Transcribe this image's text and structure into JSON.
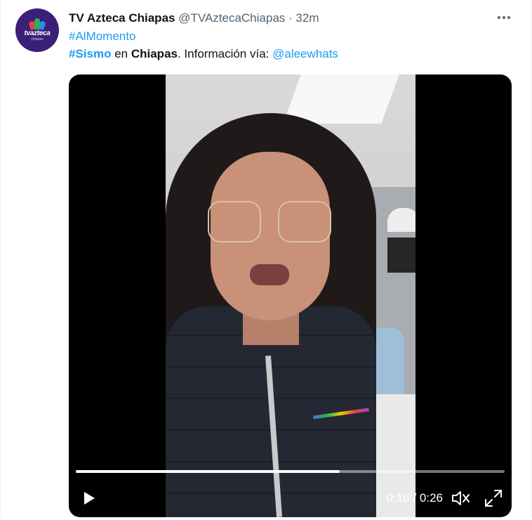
{
  "tweet": {
    "author_name": "TV Azteca Chiapas",
    "author_handle": "@TVAztecaChiapas",
    "separator": "·",
    "timestamp": "32m",
    "avatar": {
      "brand": "tvazteca",
      "sub": "chiapas"
    },
    "hashtag_line": "#AlMomento",
    "text": {
      "hashtag": "#Sismo",
      "connector": " en ",
      "place": "Chiapas",
      "rest": ". Información vía: ",
      "mention": "@aleewhats"
    }
  },
  "video": {
    "current_time": "0:16",
    "separator": " / ",
    "duration": "0:26",
    "progress_fraction": 0.615
  },
  "colors": {
    "link": "#1d9bf0",
    "text": "#0f1419",
    "muted": "#536471",
    "avatar_bg": "#3b1e78"
  },
  "icons": {
    "more": "more-options-icon",
    "play": "play-icon",
    "volume": "volume-icon",
    "fullscreen": "fullscreen-icon"
  }
}
